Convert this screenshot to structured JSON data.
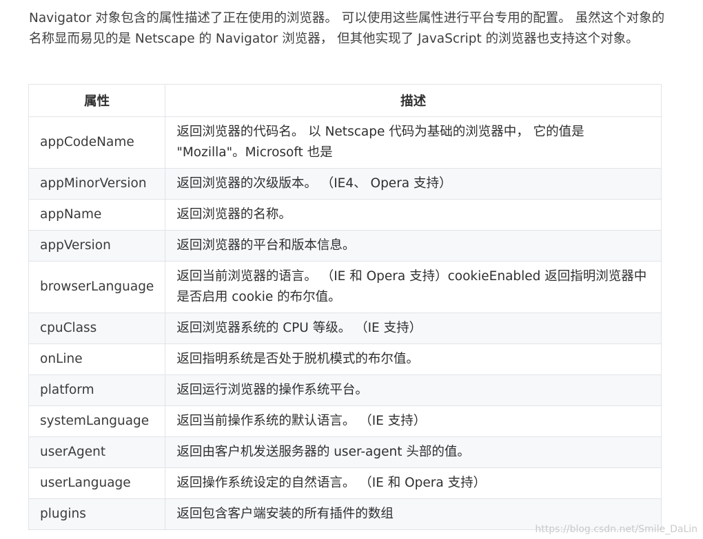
{
  "intro": "Navigator 对象包含的属性描述了正在使用的浏览器。 可以使用这些属性进行平台专用的配置。 虽然这个对象的名称显而易见的是 Netscape 的 Navigator 浏览器， 但其他实现了 JavaScript 的浏览器也支持这个对象。",
  "table": {
    "headers": [
      "属性",
      "描述"
    ],
    "rows": [
      {
        "name": "appCodeName",
        "desc": "返回浏览器的代码名。 以 Netscape 代码为基础的浏览器中， 它的值是 \"Mozilla\"。Microsoft 也是"
      },
      {
        "name": "appMinorVersion",
        "desc": "返回浏览器的次级版本。 （IE4、 Opera 支持）"
      },
      {
        "name": "appName",
        "desc": "返回浏览器的名称。"
      },
      {
        "name": "appVersion",
        "desc": "返回浏览器的平台和版本信息。"
      },
      {
        "name": "browserLanguage",
        "desc": "返回当前浏览器的语言。 （IE 和 Opera 支持）cookieEnabled 返回指明浏览器中是否启用 cookie 的布尔值。"
      },
      {
        "name": "cpuClass",
        "desc": "返回浏览器系统的 CPU 等级。 （IE 支持）"
      },
      {
        "name": "onLine",
        "desc": "返回指明系统是否处于脱机模式的布尔值。"
      },
      {
        "name": "platform",
        "desc": "返回运行浏览器的操作系统平台。"
      },
      {
        "name": "systemLanguage",
        "desc": "返回当前操作系统的默认语言。 （IE 支持）"
      },
      {
        "name": "userAgent",
        "desc": "返回由客户机发送服务器的 user-agent 头部的值。"
      },
      {
        "name": "userLanguage",
        "desc": "返回操作系统设定的自然语言。 （IE 和 Opera 支持）"
      },
      {
        "name": "plugins",
        "desc": "返回包含客户端安装的所有插件的数组"
      }
    ]
  },
  "watermark": "https://blog.csdn.net/Smile_DaLin"
}
